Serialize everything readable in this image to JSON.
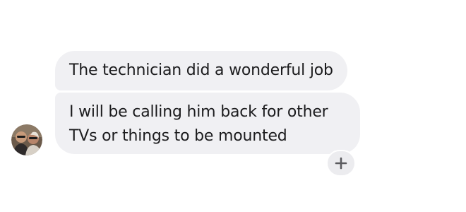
{
  "thread": {
    "messages": [
      {
        "text": "The technician did a wonderful job"
      },
      {
        "text": "I will be calling him back for other TVs or things to be mounted"
      }
    ],
    "sender": {
      "avatar_icon": "photo-avatar"
    },
    "reaction_button": {
      "icon": "plus-icon"
    }
  },
  "colors": {
    "bubble_background": "#f0f0f3",
    "text": "#1c1c1e",
    "reaction_button_background": "#ececef",
    "icon": "#5a5a5e"
  }
}
